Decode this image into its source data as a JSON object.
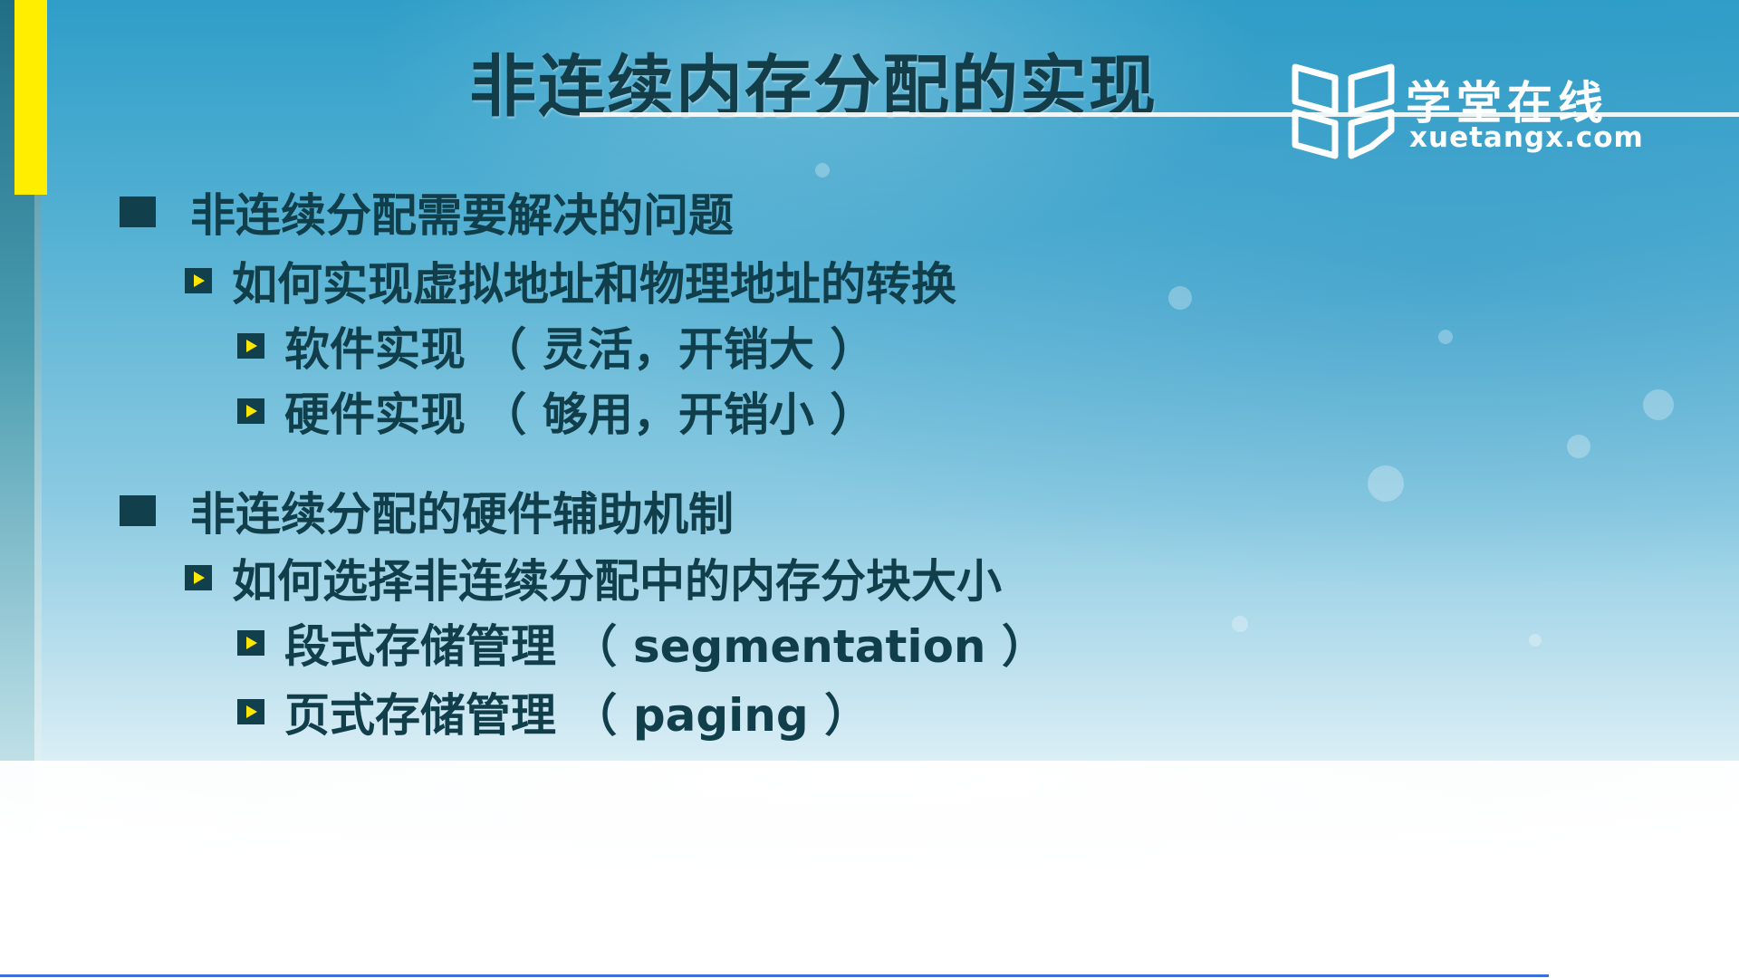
{
  "slide": {
    "title": "非连续内存分配的实现",
    "brand": {
      "name_cn": "学堂在线",
      "name_en": "xuetangx.com",
      "logo_icon": "open-book-logo-icon"
    },
    "sections": [
      {
        "heading": "非连续分配需要解决的问题",
        "sub": "如何实现虚拟地址和物理地址的转换",
        "items": [
          "软件实现 （ 灵活，开销大 ）",
          "硬件实现 （ 够用，开销小 ）"
        ]
      },
      {
        "heading": "非连续分配的硬件辅助机制",
        "sub": "如何选择非连续分配中的内存分块大小",
        "items": [
          "段式存储管理 （ segmentation ）",
          "页式存储管理 （ paging ）"
        ]
      }
    ],
    "colors": {
      "text": "#103e4a",
      "accent_bar": "#ffee00",
      "bullet_arrow": "#ffe600",
      "bottom_line": "#3b6fd9"
    }
  }
}
